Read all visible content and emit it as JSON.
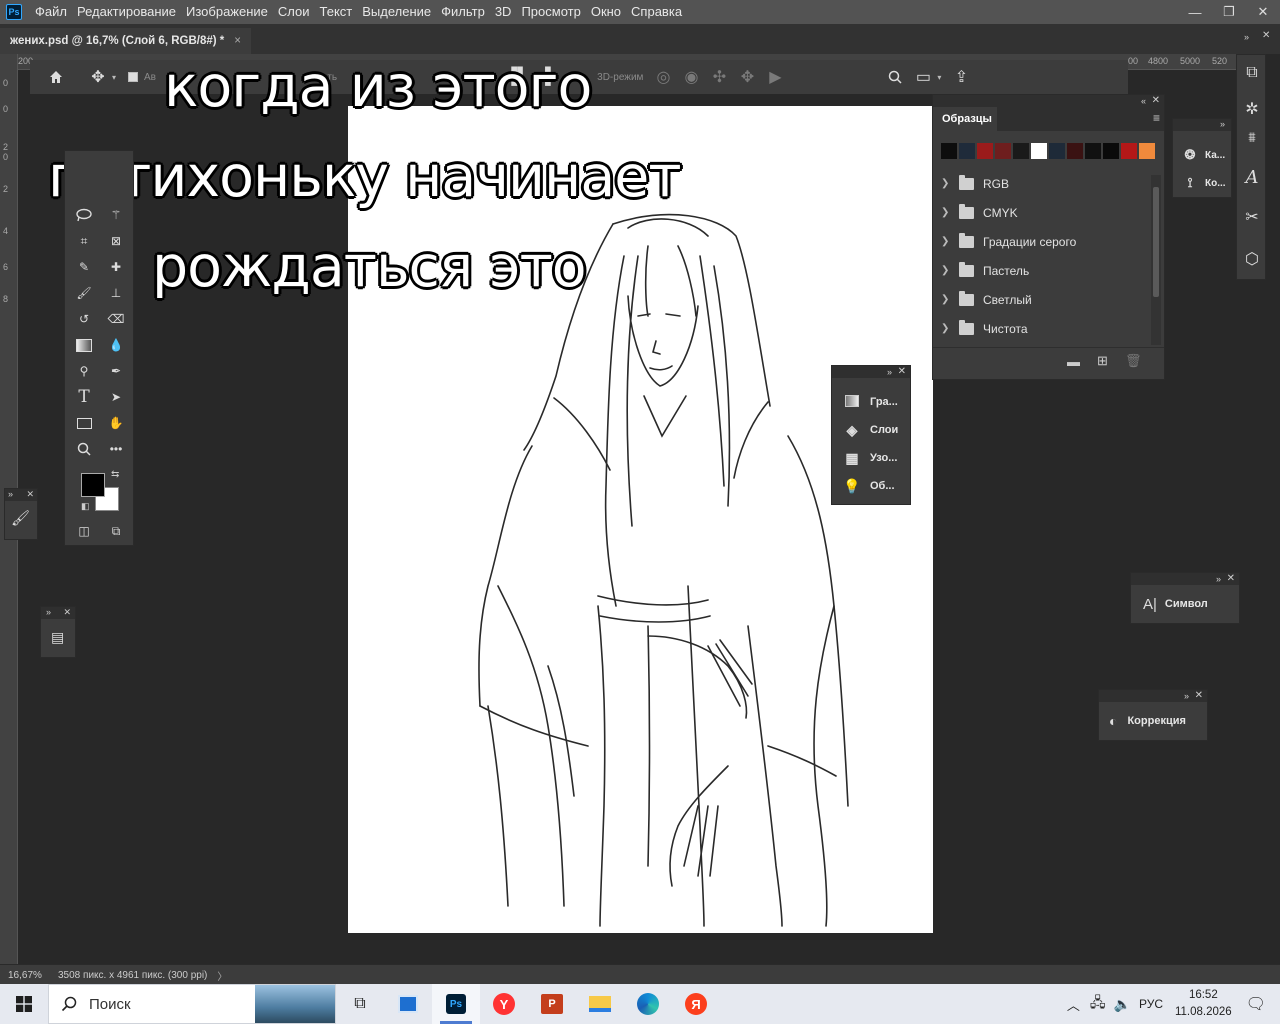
{
  "app": {
    "logo": "Ps"
  },
  "menu": [
    "Файл",
    "Редактирование",
    "Изображение",
    "Слои",
    "Текст",
    "Выделение",
    "Фильтр",
    "3D",
    "Просмотр",
    "Окно",
    "Справка"
  ],
  "window_controls": {
    "minimize": "—",
    "restore": "❐",
    "close": "✕"
  },
  "document_tab": {
    "title": "жених.psd @ 16,7% (Слой 6, RGB/8#) *",
    "close": "×"
  },
  "ruler": {
    "top_left": "200",
    "top_right": [
      "00",
      "4800",
      "5000",
      "520"
    ],
    "left": [
      "0",
      "0",
      "2",
      "0",
      "2",
      "4",
      "6",
      "8"
    ]
  },
  "options_bar": {
    "auto_label": "Ав",
    "mode_3d": "3D-режим",
    "partial_label": "ать",
    "more": "•••"
  },
  "overlay_caption": [
    "когда из этого",
    "потихоньку начинает",
    "рождаться это"
  ],
  "swatches_panel": {
    "tab": "Образцы",
    "colors": [
      "#0d0d0d",
      "#1f2b3a",
      "#9a1b1b",
      "#6e1e1e",
      "#1a1a1a",
      "#ffffff",
      "#1e2a38",
      "#3a1212",
      "#111111",
      "#0a0a0a",
      "#b41818",
      "#f08a3c"
    ],
    "groups": [
      "RGB",
      "CMYK",
      "Градации серого",
      "Пастель",
      "Светлый",
      "Чистота"
    ]
  },
  "floating_panel": {
    "items": [
      "Гра...",
      "Слои",
      "Узо...",
      "Об..."
    ]
  },
  "mini_dock": {
    "items": [
      "Ка...",
      "Ко..."
    ]
  },
  "symbol_panel": {
    "label": "Символ"
  },
  "correction_panel": {
    "label": "Коррекция"
  },
  "status": {
    "zoom": "16,67%",
    "doc_info": "3508 пикс. x 4961 пикс. (300 ppi)",
    "arrow": "〉"
  },
  "taskbar": {
    "search_placeholder": "Поиск",
    "lang": "РУС",
    "time": "16:52",
    "date": "11.08.2026"
  }
}
